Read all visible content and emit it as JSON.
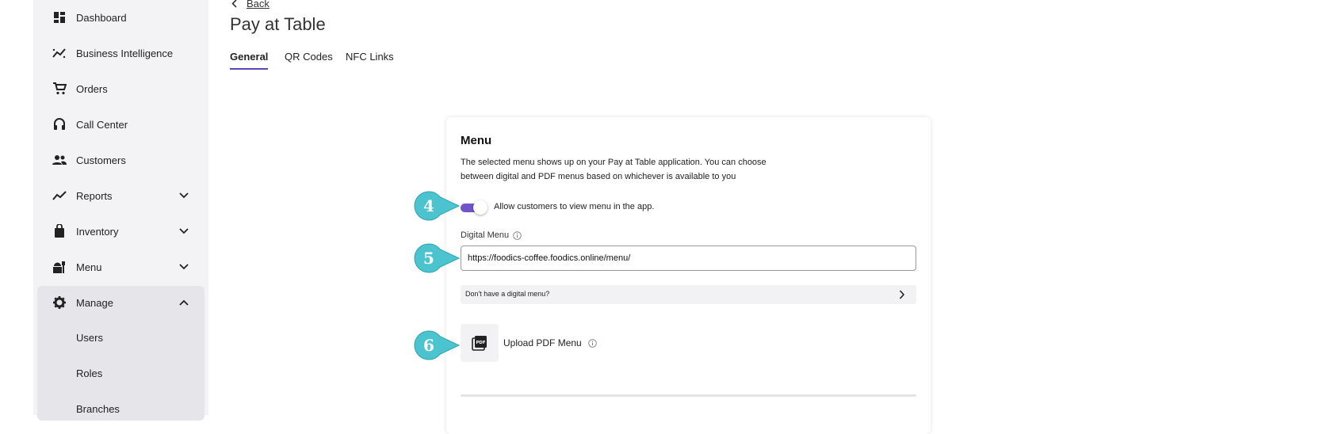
{
  "sidebar": {
    "items": [
      {
        "label": "Dashboard",
        "icon": "dashboard-icon"
      },
      {
        "label": "Business Intelligence",
        "icon": "trend-icon"
      },
      {
        "label": "Orders",
        "icon": "cart-icon"
      },
      {
        "label": "Call Center",
        "icon": "headset-icon"
      },
      {
        "label": "Customers",
        "icon": "people-icon"
      },
      {
        "label": "Reports",
        "icon": "chart-icon"
      },
      {
        "label": "Inventory",
        "icon": "bag-icon"
      },
      {
        "label": "Menu",
        "icon": "food-icon"
      },
      {
        "label": "Manage",
        "icon": "gear-icon"
      }
    ],
    "manage_sub": [
      "Users",
      "Roles",
      "Branches"
    ]
  },
  "header": {
    "back_label": "Back",
    "title": "Pay at Table",
    "tabs": [
      "General",
      "QR Codes",
      "NFC Links"
    ],
    "active_tab": "General"
  },
  "card": {
    "title": "Menu",
    "description_line1": "The selected menu shows up on your Pay at Table application. You can choose",
    "description_line2": "between digital and PDF menus based on whichever is available to you",
    "toggle_label": "Allow customers to view menu in the app.",
    "toggle_on": true,
    "digital_menu_label": "Digital Menu",
    "digital_menu_value": "https://foodics-coffee.foodics.online/menu/",
    "no_digital_menu_label": "Don't have a digital menu?",
    "upload_label": "Upload PDF Menu",
    "upload_icon_text": "PDF"
  },
  "steps": [
    "4",
    "5",
    "6"
  ],
  "colors": {
    "accent": "#6f55c9",
    "step_callout": "#4cc4cf",
    "sidebar_bg": "#f3f3f6"
  }
}
